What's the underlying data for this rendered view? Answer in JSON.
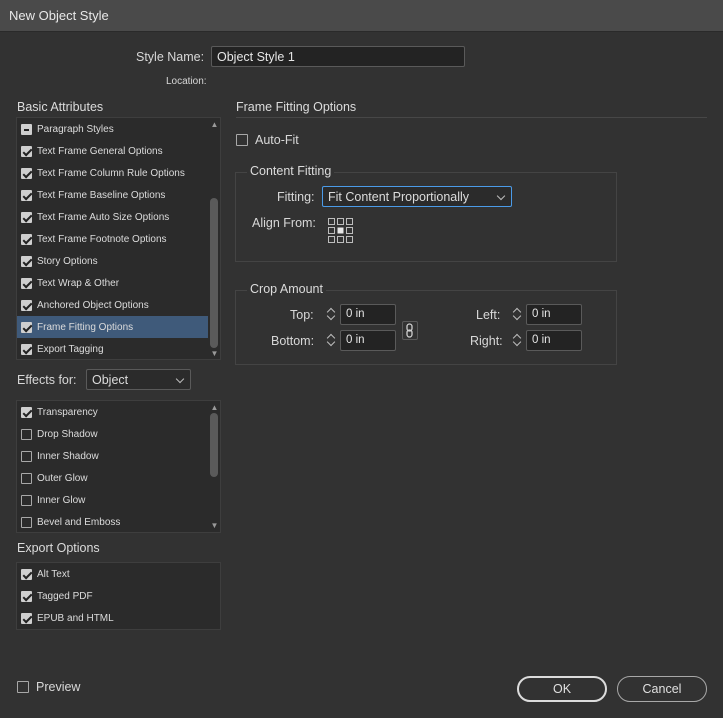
{
  "window": {
    "title": "New Object Style"
  },
  "style_name": {
    "label": "Style Name:",
    "value": "Object Style 1"
  },
  "location": {
    "label": "Location:"
  },
  "basic_attributes": {
    "heading": "Basic Attributes",
    "items": [
      {
        "label": "Paragraph Styles",
        "state": "mixed"
      },
      {
        "label": "Text Frame General Options",
        "state": "checked"
      },
      {
        "label": "Text Frame Column Rule Options",
        "state": "checked"
      },
      {
        "label": "Text Frame Baseline Options",
        "state": "checked"
      },
      {
        "label": "Text Frame Auto Size Options",
        "state": "checked"
      },
      {
        "label": "Text Frame Footnote Options",
        "state": "checked"
      },
      {
        "label": "Story Options",
        "state": "checked"
      },
      {
        "label": "Text Wrap & Other",
        "state": "checked"
      },
      {
        "label": "Anchored Object Options",
        "state": "checked"
      },
      {
        "label": "Frame Fitting Options",
        "state": "checked",
        "selected": true
      },
      {
        "label": "Export Tagging",
        "state": "checked"
      }
    ]
  },
  "effects_for": {
    "label": "Effects for:",
    "value": "Object",
    "items": [
      {
        "label": "Transparency",
        "state": "checked"
      },
      {
        "label": "Drop Shadow",
        "state": "unchecked"
      },
      {
        "label": "Inner Shadow",
        "state": "unchecked"
      },
      {
        "label": "Outer Glow",
        "state": "unchecked"
      },
      {
        "label": "Inner Glow",
        "state": "unchecked"
      },
      {
        "label": "Bevel and Emboss",
        "state": "unchecked"
      }
    ]
  },
  "export_options": {
    "heading": "Export Options",
    "items": [
      {
        "label": "Alt Text",
        "state": "checked"
      },
      {
        "label": "Tagged PDF",
        "state": "checked"
      },
      {
        "label": "EPUB and HTML",
        "state": "checked"
      }
    ]
  },
  "panel": {
    "title": "Frame Fitting Options",
    "auto_fit": {
      "label": "Auto-Fit",
      "checked": false
    },
    "content_fitting": {
      "title": "Content Fitting",
      "fitting_label": "Fitting:",
      "fitting_value": "Fit Content Proportionally",
      "align_from_label": "Align From:"
    },
    "crop_amount": {
      "title": "Crop Amount",
      "top_label": "Top:",
      "top_value": "0 in",
      "bottom_label": "Bottom:",
      "bottom_value": "0 in",
      "left_label": "Left:",
      "left_value": "0 in",
      "right_label": "Right:",
      "right_value": "0 in"
    }
  },
  "footer": {
    "preview_label": "Preview",
    "ok_label": "OK",
    "cancel_label": "Cancel"
  },
  "colors": {
    "background": "#323232",
    "titlebar": "#4a4a4a",
    "selection": "#3f5a7a",
    "focus": "#4b9be8"
  }
}
